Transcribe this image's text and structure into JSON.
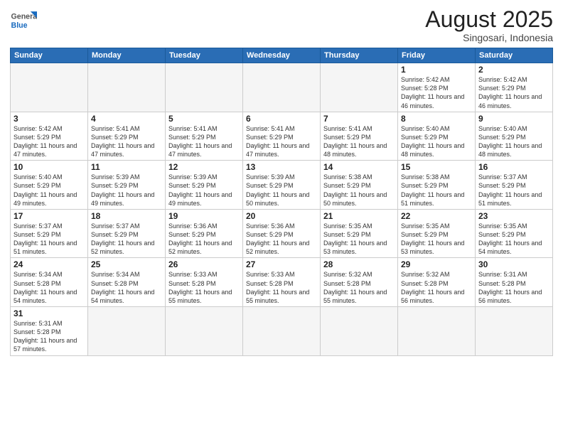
{
  "header": {
    "logo_general": "General",
    "logo_blue": "Blue",
    "month_title": "August 2025",
    "subtitle": "Singosari, Indonesia"
  },
  "weekdays": [
    "Sunday",
    "Monday",
    "Tuesday",
    "Wednesday",
    "Thursday",
    "Friday",
    "Saturday"
  ],
  "weeks": [
    [
      {
        "day": "",
        "info": "",
        "empty": true
      },
      {
        "day": "",
        "info": "",
        "empty": true
      },
      {
        "day": "",
        "info": "",
        "empty": true
      },
      {
        "day": "",
        "info": "",
        "empty": true
      },
      {
        "day": "",
        "info": "",
        "empty": true
      },
      {
        "day": "1",
        "info": "Sunrise: 5:42 AM\nSunset: 5:28 PM\nDaylight: 11 hours\nand 46 minutes."
      },
      {
        "day": "2",
        "info": "Sunrise: 5:42 AM\nSunset: 5:29 PM\nDaylight: 11 hours\nand 46 minutes."
      }
    ],
    [
      {
        "day": "3",
        "info": "Sunrise: 5:42 AM\nSunset: 5:29 PM\nDaylight: 11 hours\nand 47 minutes."
      },
      {
        "day": "4",
        "info": "Sunrise: 5:41 AM\nSunset: 5:29 PM\nDaylight: 11 hours\nand 47 minutes."
      },
      {
        "day": "5",
        "info": "Sunrise: 5:41 AM\nSunset: 5:29 PM\nDaylight: 11 hours\nand 47 minutes."
      },
      {
        "day": "6",
        "info": "Sunrise: 5:41 AM\nSunset: 5:29 PM\nDaylight: 11 hours\nand 47 minutes."
      },
      {
        "day": "7",
        "info": "Sunrise: 5:41 AM\nSunset: 5:29 PM\nDaylight: 11 hours\nand 48 minutes."
      },
      {
        "day": "8",
        "info": "Sunrise: 5:40 AM\nSunset: 5:29 PM\nDaylight: 11 hours\nand 48 minutes."
      },
      {
        "day": "9",
        "info": "Sunrise: 5:40 AM\nSunset: 5:29 PM\nDaylight: 11 hours\nand 48 minutes."
      }
    ],
    [
      {
        "day": "10",
        "info": "Sunrise: 5:40 AM\nSunset: 5:29 PM\nDaylight: 11 hours\nand 49 minutes."
      },
      {
        "day": "11",
        "info": "Sunrise: 5:39 AM\nSunset: 5:29 PM\nDaylight: 11 hours\nand 49 minutes."
      },
      {
        "day": "12",
        "info": "Sunrise: 5:39 AM\nSunset: 5:29 PM\nDaylight: 11 hours\nand 49 minutes."
      },
      {
        "day": "13",
        "info": "Sunrise: 5:39 AM\nSunset: 5:29 PM\nDaylight: 11 hours\nand 50 minutes."
      },
      {
        "day": "14",
        "info": "Sunrise: 5:38 AM\nSunset: 5:29 PM\nDaylight: 11 hours\nand 50 minutes."
      },
      {
        "day": "15",
        "info": "Sunrise: 5:38 AM\nSunset: 5:29 PM\nDaylight: 11 hours\nand 51 minutes."
      },
      {
        "day": "16",
        "info": "Sunrise: 5:37 AM\nSunset: 5:29 PM\nDaylight: 11 hours\nand 51 minutes."
      }
    ],
    [
      {
        "day": "17",
        "info": "Sunrise: 5:37 AM\nSunset: 5:29 PM\nDaylight: 11 hours\nand 51 minutes."
      },
      {
        "day": "18",
        "info": "Sunrise: 5:37 AM\nSunset: 5:29 PM\nDaylight: 11 hours\nand 52 minutes."
      },
      {
        "day": "19",
        "info": "Sunrise: 5:36 AM\nSunset: 5:29 PM\nDaylight: 11 hours\nand 52 minutes."
      },
      {
        "day": "20",
        "info": "Sunrise: 5:36 AM\nSunset: 5:29 PM\nDaylight: 11 hours\nand 52 minutes."
      },
      {
        "day": "21",
        "info": "Sunrise: 5:35 AM\nSunset: 5:29 PM\nDaylight: 11 hours\nand 53 minutes."
      },
      {
        "day": "22",
        "info": "Sunrise: 5:35 AM\nSunset: 5:29 PM\nDaylight: 11 hours\nand 53 minutes."
      },
      {
        "day": "23",
        "info": "Sunrise: 5:35 AM\nSunset: 5:29 PM\nDaylight: 11 hours\nand 54 minutes."
      }
    ],
    [
      {
        "day": "24",
        "info": "Sunrise: 5:34 AM\nSunset: 5:28 PM\nDaylight: 11 hours\nand 54 minutes."
      },
      {
        "day": "25",
        "info": "Sunrise: 5:34 AM\nSunset: 5:28 PM\nDaylight: 11 hours\nand 54 minutes."
      },
      {
        "day": "26",
        "info": "Sunrise: 5:33 AM\nSunset: 5:28 PM\nDaylight: 11 hours\nand 55 minutes."
      },
      {
        "day": "27",
        "info": "Sunrise: 5:33 AM\nSunset: 5:28 PM\nDaylight: 11 hours\nand 55 minutes."
      },
      {
        "day": "28",
        "info": "Sunrise: 5:32 AM\nSunset: 5:28 PM\nDaylight: 11 hours\nand 55 minutes."
      },
      {
        "day": "29",
        "info": "Sunrise: 5:32 AM\nSunset: 5:28 PM\nDaylight: 11 hours\nand 56 minutes."
      },
      {
        "day": "30",
        "info": "Sunrise: 5:31 AM\nSunset: 5:28 PM\nDaylight: 11 hours\nand 56 minutes."
      }
    ],
    [
      {
        "day": "31",
        "info": "Sunrise: 5:31 AM\nSunset: 5:28 PM\nDaylight: 11 hours\nand 57 minutes."
      },
      {
        "day": "",
        "info": "",
        "empty": true
      },
      {
        "day": "",
        "info": "",
        "empty": true
      },
      {
        "day": "",
        "info": "",
        "empty": true
      },
      {
        "day": "",
        "info": "",
        "empty": true
      },
      {
        "day": "",
        "info": "",
        "empty": true
      },
      {
        "day": "",
        "info": "",
        "empty": true
      }
    ]
  ]
}
